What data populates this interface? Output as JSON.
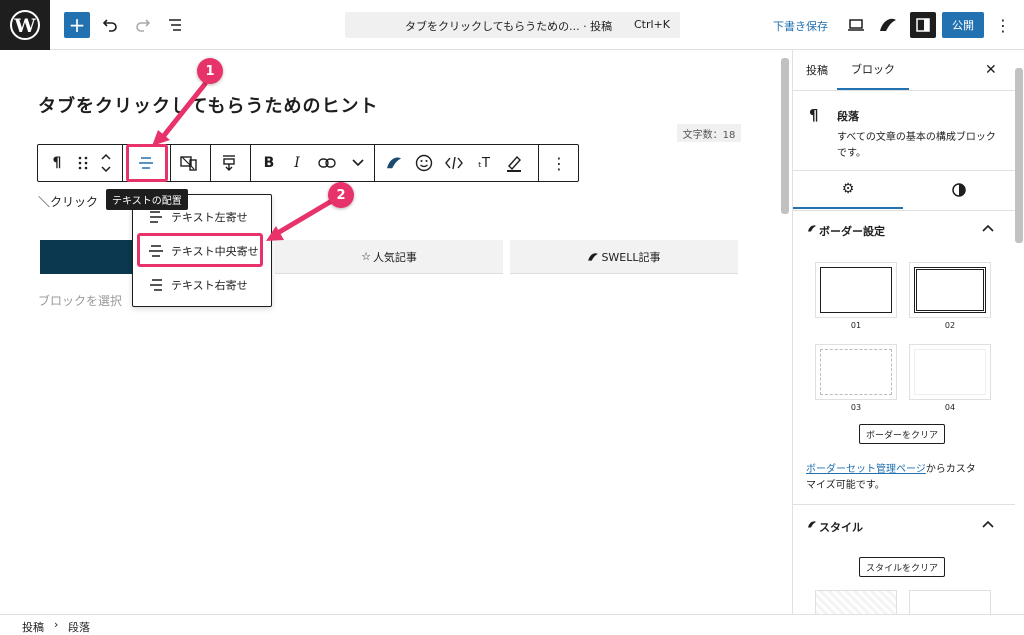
{
  "header": {
    "command_title": "タブをクリックしてもらうための... · 投稿",
    "shortcut": "Ctrl+K",
    "draft_label": "下書き保存",
    "publish_label": "公開"
  },
  "editor": {
    "post_title": "タブをクリックしてもらうためのヒント",
    "word_count": "文字数：18",
    "tooltip": "テキストの配置",
    "paragraph_prefix": "＼クリック",
    "placeholder": "ブロックを選択",
    "tabs": [
      "人気記事",
      "SWELL記事"
    ],
    "align_menu": [
      "テキスト左寄せ",
      "テキスト中央寄せ",
      "テキスト右寄せ"
    ],
    "annotation_1": "1",
    "annotation_2": "2",
    "accent": "#e8336a",
    "tab_active_color": "#0b384f"
  },
  "sidebar": {
    "tab_post": "投稿",
    "tab_block": "ブロック",
    "block_name": "段落",
    "block_desc_1": "すべての文章の基本の構成ブロック",
    "block_desc_2": "です。",
    "border_section": "ボーダー設定",
    "border_labels": [
      "01",
      "02",
      "03",
      "04"
    ],
    "border_clear": "ボーダーをクリア",
    "border_link": "ボーダーセット管理ページ",
    "border_note_1": "からカスタ",
    "border_note_2": "マイズ可能です。",
    "style_section": "スタイル",
    "style_clear": "スタイルをクリア"
  },
  "footer": {
    "crumb_1": "投稿",
    "crumb_2": "段落"
  }
}
